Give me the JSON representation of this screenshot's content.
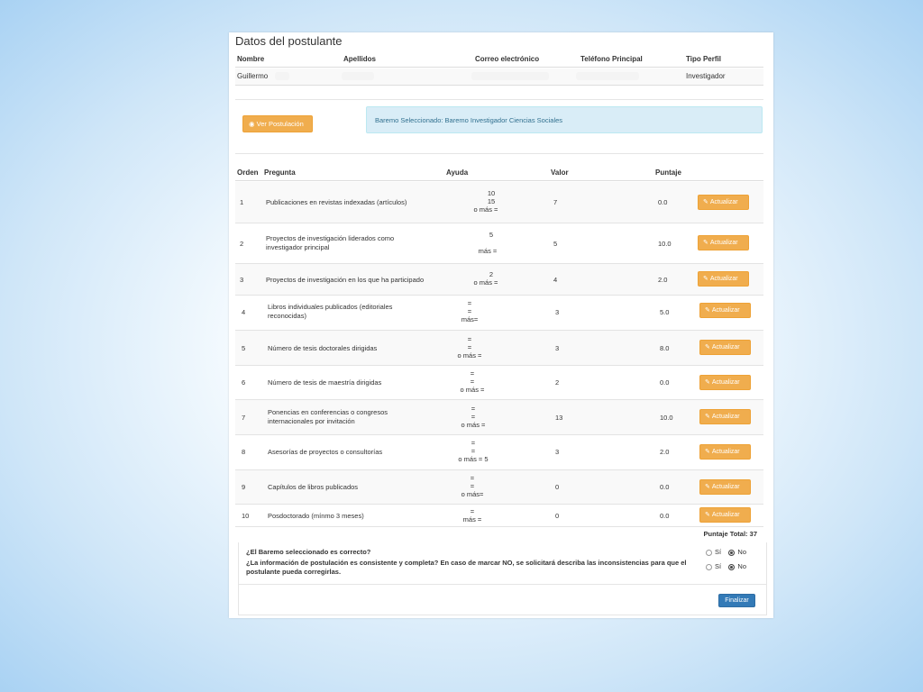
{
  "applicant": {
    "title": "Datos del postulante",
    "columns": [
      "Nombre",
      "Apellidos",
      "Correo electrónico",
      "Teléfono Principal",
      "Tipo Perfil"
    ],
    "values": {
      "nombre": "Guillermo",
      "tipo_perfil": "Investigador"
    }
  },
  "actions": {
    "ver_postulacion": "Ver Postulación",
    "baremo_info": "Baremo Seleccionado: Baremo Investigador Ciencias Sociales"
  },
  "table": {
    "headers": [
      "Orden",
      "Pregunta",
      "Ayuda",
      "Valor",
      "Puntaje"
    ],
    "rows": [
      {
        "orden": "1",
        "pregunta": "Publicaciones en revistas indexadas (artículos)",
        "ayuda": [
          "10",
          "15",
          "o más ="
        ],
        "valor": "7",
        "puntaje": "0.0",
        "boton": "Actualizar"
      },
      {
        "orden": "2",
        "pregunta": "Proyectos de investigación liderados como investigador principal",
        "ayuda": [
          "5",
          "",
          "más ="
        ],
        "valor": "5",
        "puntaje": "10.0",
        "boton": "Actualizar"
      },
      {
        "orden": "3",
        "pregunta": "Proyectos de investigación en los que ha participado",
        "ayuda": [
          "2",
          "o más ="
        ],
        "valor": "4",
        "puntaje": "2.0",
        "boton": "Actualizar"
      },
      {
        "orden": "4",
        "pregunta": "Libros individuales publicados (editoriales reconocidas)",
        "ayuda": [
          "=",
          "=",
          "más="
        ],
        "valor": "3",
        "puntaje": "5.0",
        "boton": "Actualizar"
      },
      {
        "orden": "5",
        "pregunta": "Número de tesis doctorales dirigidas",
        "ayuda": [
          "=",
          "=",
          "o más ="
        ],
        "valor": "3",
        "puntaje": "8.0",
        "boton": "Actualizar"
      },
      {
        "orden": "6",
        "pregunta": "Número de tesis de maestría dirigidas",
        "ayuda": [
          "=",
          "=",
          "o más ="
        ],
        "valor": "2",
        "puntaje": "0.0",
        "boton": "Actualizar"
      },
      {
        "orden": "7",
        "pregunta": "Ponencias en conferencias o congresos internacionales por invitación",
        "ayuda": [
          "=",
          "=",
          "o más ="
        ],
        "valor": "13",
        "puntaje": "10.0",
        "boton": "Actualizar"
      },
      {
        "orden": "8",
        "pregunta": "Asesorías de proyectos o consultorías",
        "ayuda": [
          "=",
          "=",
          "o más = 5"
        ],
        "valor": "3",
        "puntaje": "2.0",
        "boton": "Actualizar"
      },
      {
        "orden": "9",
        "pregunta": "Capítulos de libros publicados",
        "ayuda": [
          "=",
          "=",
          "o más="
        ],
        "valor": "0",
        "puntaje": "0.0",
        "boton": "Actualizar"
      },
      {
        "orden": "10",
        "pregunta": "Posdoctorado (mínmo 3 meses)",
        "ayuda": [
          "=",
          "más ="
        ],
        "valor": "0",
        "puntaje": "0.0",
        "boton": "Actualizar"
      }
    ],
    "total": "Puntaje Total: 37"
  },
  "questions": [
    {
      "text": "¿El Baremo seleccionado es correcto?",
      "options": [
        "Sí",
        "No"
      ],
      "selected": "No"
    },
    {
      "text": "¿La información de postulación es consistente y completa? En caso de marcar NO, se solicitará describa las inconsistencias para que el postulante pueda corregirlas.",
      "options": [
        "Sí",
        "No"
      ],
      "selected": "No"
    }
  ],
  "finalizar": "Finalizar"
}
